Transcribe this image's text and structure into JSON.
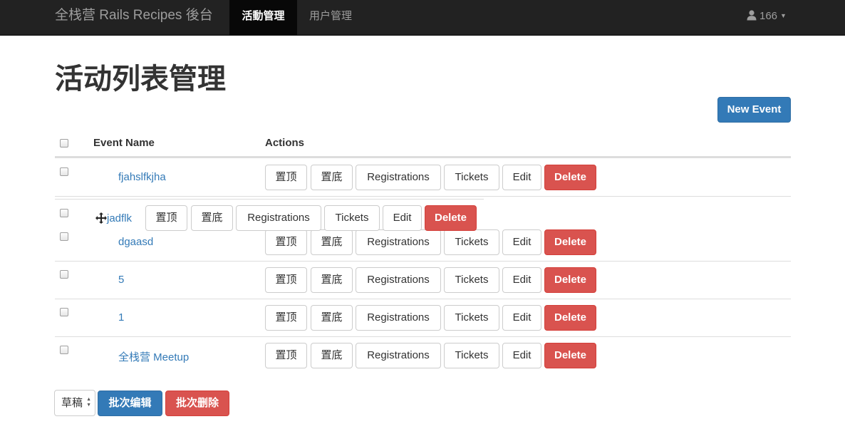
{
  "navbar": {
    "brand": "全栈营 Rails Recipes 後台",
    "items": [
      {
        "label": "活動管理",
        "active": true
      },
      {
        "label": "用户管理",
        "active": false
      }
    ],
    "user": {
      "icon": "user-icon",
      "name": "166"
    }
  },
  "page": {
    "title": "活动列表管理"
  },
  "toolbar": {
    "new_event_label": "New Event"
  },
  "table": {
    "headers": {
      "name": "Event Name",
      "actions": "Actions"
    },
    "action_labels": {
      "top": "置顶",
      "bottom": "置底",
      "registrations": "Registrations",
      "tickets": "Tickets",
      "edit": "Edit",
      "delete": "Delete"
    },
    "rows": [
      {
        "name": "fjahslfkjha"
      },
      {
        "name": "dgaasd"
      },
      {
        "name": "5"
      },
      {
        "name": "1"
      },
      {
        "name": "全栈营 Meetup"
      }
    ],
    "dragging_row": {
      "name": "jadflk",
      "icon": "move-icon"
    }
  },
  "bulk": {
    "status_select": "草稿",
    "edit_label": "批次编辑",
    "delete_label": "批次删除"
  },
  "colors": {
    "navbar_bg": "#222222",
    "primary": "#337ab7",
    "danger": "#d9534f",
    "link": "#337ab7"
  }
}
